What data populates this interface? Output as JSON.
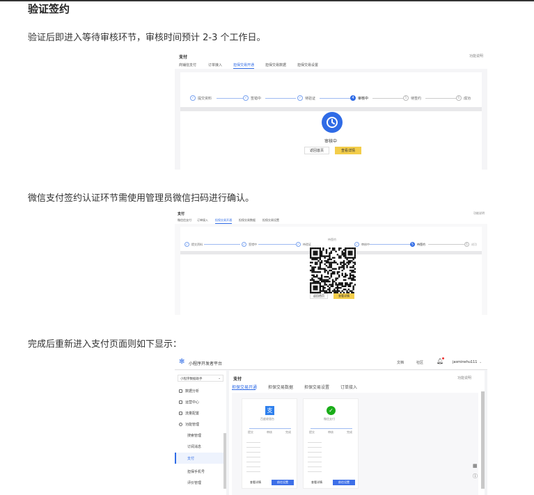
{
  "heading": "验证签约",
  "para1": "验证后即进入等待审核环节，审核时间预计 2-3 个工作日。",
  "para2": "微信支付签约认证环节需使用管理员微信扫码进行确认。",
  "para3": "完成后重新进入支付页面则如下显示：",
  "shot1": {
    "title": "支付",
    "help": "功能说明",
    "tabs": [
      "商铺信支付",
      "订单接入",
      "担保交易开通",
      "担保交易数据",
      "担保交易设置"
    ],
    "steps": [
      "提交资料",
      "签错中",
      "待验证",
      "审核中",
      "待签约",
      "成功"
    ],
    "status": "审核中",
    "btn_back": "返回首页",
    "btn_view": "查看详情"
  },
  "shot2": {
    "title": "支付",
    "help": "功能说明",
    "tabs": [
      "微信信支付",
      "订单接入",
      "担保交易开通",
      "担保交易数据",
      "担保交易设置"
    ],
    "steps": [
      "提交资料",
      "签错中",
      "待验证",
      "审核中",
      "待签约",
      "成功"
    ],
    "qr_caption": "待签约",
    "btn_back": "返回首页",
    "btn_view": "查看详情"
  },
  "shot3": {
    "brand": "小程序开发者平台",
    "nav": [
      "文档",
      "社区"
    ],
    "user": "jasminehu111",
    "account": "小程序数据助手",
    "page_title": "支付",
    "help": "功能说明",
    "tabs": [
      "担保交易开通",
      "担保交易数据",
      "担保交易设置",
      "订单接入"
    ],
    "menu": [
      "数据分析",
      "运营中心",
      "流量配置",
      "功能管理",
      "搜索管理",
      "订阅消息",
      "支付",
      "担保手机号",
      "评价管理"
    ],
    "card1_name": "百度收银台",
    "card2_name": "微信支付",
    "steps": [
      "提交",
      "审核",
      "完成"
    ],
    "btn_detail": "查看详情",
    "btn_open": "前往设置",
    "colors": {
      "accent": "#2f6be6",
      "wechat": "#1aad19"
    }
  }
}
